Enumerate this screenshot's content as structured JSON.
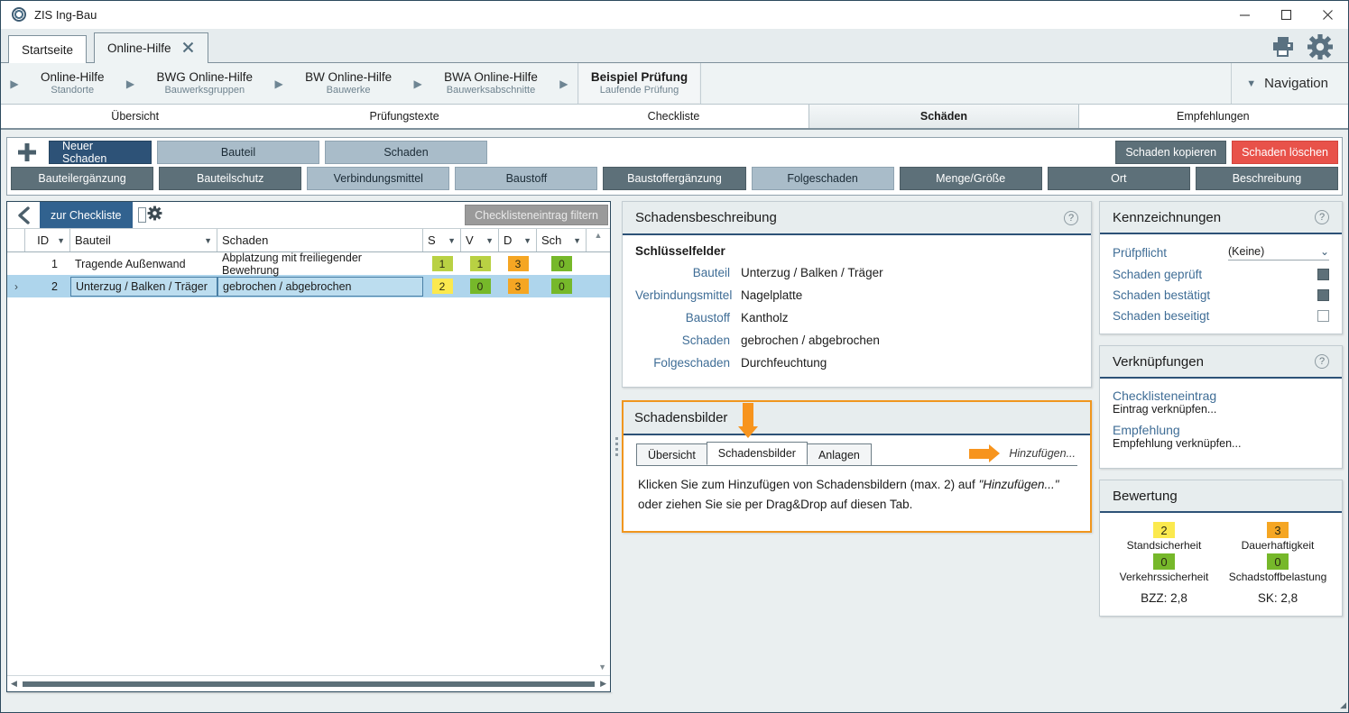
{
  "window": {
    "title": "ZIS Ing-Bau",
    "logo_icon": "app-circle-icon",
    "minimize_icon": "minimize-icon",
    "maximize_icon": "maximize-icon",
    "close_icon": "close-icon"
  },
  "tabstrip": {
    "tabs": [
      {
        "label": "Startseite",
        "closable": false,
        "active": false
      },
      {
        "label": "Online-Hilfe",
        "closable": true,
        "active": true,
        "close_icon": "close-icon"
      }
    ],
    "actions": [
      {
        "name": "print-icon",
        "label": "Drucken"
      },
      {
        "name": "gear-icon",
        "label": "Einstellungen"
      }
    ]
  },
  "breadcrumb": {
    "items": [
      {
        "title": "Online-Hilfe",
        "sub": "Standorte",
        "current": false
      },
      {
        "title": "BWG Online-Hilfe",
        "sub": "Bauwerksgruppen",
        "current": false
      },
      {
        "title": "BW Online-Hilfe",
        "sub": "Bauwerke",
        "current": false
      },
      {
        "title": "BWA Online-Hilfe",
        "sub": "Bauwerksabschnitte",
        "current": false
      },
      {
        "title": "Beispiel Prüfung",
        "sub": "Laufende Prüfung",
        "current": true
      }
    ],
    "navigation_label": "Navigation",
    "navigation_caret": "chevron-down-icon"
  },
  "section_tabs": [
    {
      "label": "Übersicht",
      "active": false
    },
    {
      "label": "Prüfungstexte",
      "active": false
    },
    {
      "label": "Checkliste",
      "active": false
    },
    {
      "label": "Schäden",
      "active": true
    },
    {
      "label": "Empfehlungen",
      "active": false
    }
  ],
  "commandbar": {
    "plus_icon": "plus-icon",
    "new_damage": "Neuer Schaden",
    "row1": [
      {
        "label": "Bauteil",
        "style": "light"
      },
      {
        "label": "Schaden",
        "style": "light"
      }
    ],
    "copy": "Schaden kopieren",
    "delete": "Schaden löschen",
    "row2": [
      {
        "label": "Bauteilergänzung",
        "style": "dark"
      },
      {
        "label": "Bauteilschutz",
        "style": "dark"
      },
      {
        "label": "Verbindungsmittel",
        "style": "light"
      },
      {
        "label": "Baustoff",
        "style": "light"
      },
      {
        "label": "Baustoffergänzung",
        "style": "dark"
      },
      {
        "label": "Folgeschaden",
        "style": "light"
      },
      {
        "label": "Menge/Größe",
        "style": "dark"
      },
      {
        "label": "Ort",
        "style": "dark"
      },
      {
        "label": "Beschreibung",
        "style": "dark"
      }
    ]
  },
  "grid": {
    "back_icon": "chevron-left-icon",
    "back_label": "zur Checkliste",
    "gear_icon": "gear-icon",
    "filter_button": "Checklisteneintrag filtern",
    "columns": [
      {
        "key": "id",
        "label": "ID"
      },
      {
        "key": "bauteil",
        "label": "Bauteil"
      },
      {
        "key": "schaden",
        "label": "Schaden"
      },
      {
        "key": "s",
        "label": "S"
      },
      {
        "key": "v",
        "label": "V"
      },
      {
        "key": "d",
        "label": "D"
      },
      {
        "key": "sch",
        "label": "Sch"
      }
    ],
    "filter_icon": "filter-icon",
    "rows": [
      {
        "id": "1",
        "bauteil": "Tragende Außenwand",
        "schaden": "Abplatzung mit freiliegender Bewehrung",
        "s": "1",
        "v": "1",
        "d": "3",
        "sch": "0",
        "s_color": "#b9d143",
        "v_color": "#b9d143",
        "d_color": "#f5a623",
        "sch_color": "#76b82a",
        "selected": false,
        "indicator": ""
      },
      {
        "id": "2",
        "bauteil": "Unterzug / Balken / Träger",
        "schaden": "gebrochen / abgebrochen",
        "s": "2",
        "v": "0",
        "d": "3",
        "sch": "0",
        "s_color": "#fbe94e",
        "v_color": "#76b82a",
        "d_color": "#f5a623",
        "sch_color": "#76b82a",
        "selected": true,
        "indicator": "›"
      }
    ]
  },
  "schadensbeschreibung": {
    "title": "Schadensbeschreibung",
    "help_icon": "help-icon",
    "subtitle": "Schlüsselfelder",
    "fields": [
      {
        "key": "Bauteil",
        "value": "Unterzug / Balken / Träger"
      },
      {
        "key": "Verbindungsmittel",
        "value": "Nagelplatte"
      },
      {
        "key": "Baustoff",
        "value": "Kantholz"
      },
      {
        "key": "Schaden",
        "value": "gebrochen / abgebrochen"
      },
      {
        "key": "Folgeschaden",
        "value": "Durchfeuchtung"
      }
    ]
  },
  "schadensbilder": {
    "title": "Schadensbilder",
    "highlight_color": "#f0961e",
    "down_arrow_icon": "arrow-down-icon",
    "right_arrow_icon": "arrow-right-icon",
    "tabs": [
      {
        "label": "Übersicht",
        "active": false
      },
      {
        "label": "Schadensbilder",
        "active": true
      },
      {
        "label": "Anlagen",
        "active": false
      }
    ],
    "add_link": "Hinzufügen...",
    "message_line1_prefix": "Klicken Sie zum Hinzufügen von Schadensbildern (max. 2) auf ",
    "message_line1_em": "\"Hinzufügen...\"",
    "message_line2": "oder ziehen Sie sie per Drag&Drop auf diesen Tab."
  },
  "kennzeichnungen": {
    "title": "Kennzeichnungen",
    "help_icon": "help-icon",
    "pruefpflicht_label": "Prüfpflicht",
    "pruefpflicht_value": "(Keine)",
    "caret_icon": "chevron-down-icon",
    "checks": [
      {
        "label": "Schaden geprüft",
        "checked": true
      },
      {
        "label": "Schaden bestätigt",
        "checked": true
      },
      {
        "label": "Schaden beseitigt",
        "checked": false
      }
    ]
  },
  "verknuepfungen": {
    "title": "Verknüpfungen",
    "help_icon": "help-icon",
    "links": [
      {
        "title": "Checklisteneintrag",
        "sub": "Eintrag verknüpfen..."
      },
      {
        "title": "Empfehlung",
        "sub": "Empfehlung verknüpfen..."
      }
    ]
  },
  "bewertung": {
    "title": "Bewertung",
    "items": [
      {
        "value": "2",
        "label": "Standsicherheit",
        "color": "#fbe94e"
      },
      {
        "value": "3",
        "label": "Dauerhaftigkeit",
        "color": "#f5a623"
      },
      {
        "value": "0",
        "label": "Verkehrssicherheit",
        "color": "#76b82a"
      },
      {
        "value": "0",
        "label": "Schadstoffbelastung",
        "color": "#76b82a"
      }
    ],
    "totals": [
      {
        "label": "BZZ: 2,8"
      },
      {
        "label": "SK: 2,8"
      }
    ]
  },
  "colors": {
    "accent": "#2d5277",
    "danger": "#e8524a",
    "highlight": "#f0961e",
    "selection": "#aed5ec"
  }
}
